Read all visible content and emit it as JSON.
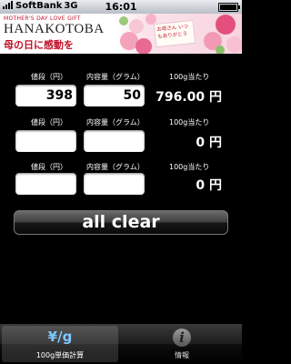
{
  "status_bar": {
    "carrier": "SoftBank",
    "network": "3G",
    "time": "16:01"
  },
  "banner": {
    "subtitle": "MOTHER'S DAY LOVE GIFT",
    "brand": "HANAKOTOBA",
    "headline": "母の日に感動を",
    "card_text": "お母さん いつもありがとう"
  },
  "labels": {
    "price": "値段（円）",
    "volume": "内容量（グラム）",
    "per100": "100g当たり"
  },
  "rows": [
    {
      "price": "398",
      "volume": "50",
      "result": "796.00 円"
    },
    {
      "price": "",
      "volume": "",
      "result": "0 円"
    },
    {
      "price": "",
      "volume": "",
      "result": "0 円"
    }
  ],
  "clear_label": "all clear",
  "tabs": [
    {
      "icon_text": "¥/g",
      "label": "100g単価計算",
      "icon": "yen-per-gram-icon"
    },
    {
      "icon_text": "i",
      "label": "情報",
      "icon": "info-icon"
    }
  ]
}
